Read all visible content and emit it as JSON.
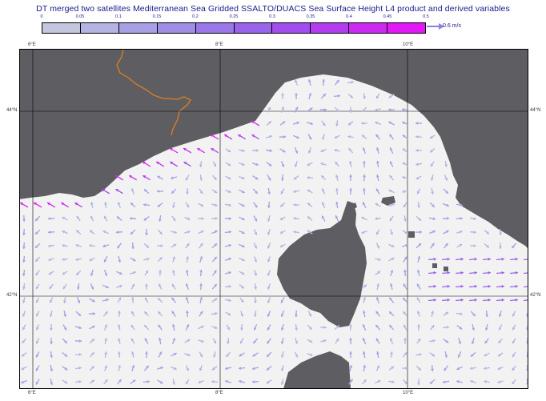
{
  "title": "DT merged two satellites Mediterranean Sea Gridded SSALTO/DUACS Sea Surface Height L4 product and derived variables",
  "colorbar": {
    "ticks": [
      "0",
      "0.05",
      "0.1",
      "0.15",
      "0.2",
      "0.25",
      "0.3",
      "0.35",
      "0.4",
      "0.45",
      "0.5"
    ],
    "colors": [
      "#c4c6dd",
      "#b4b3e3",
      "#a8a0e5",
      "#9f8de8",
      "#9a78ea",
      "#9a63ec",
      "#a24eee",
      "#b43cf0",
      "#cc2af2",
      "#e318f6"
    ],
    "unit": "0.6 m/s"
  },
  "axes": {
    "lon_labels": [
      "6°E",
      "8°E",
      "10°E"
    ],
    "lat_labels": [
      "44°N",
      "42°N"
    ],
    "lon_range": [
      5.85,
      11.05
    ],
    "lat_range": [
      40.9,
      44.65
    ]
  },
  "colors": {
    "sea": "#f2f2f2",
    "land": "#5e5e62",
    "border": "#e07d20",
    "grid": "#000000",
    "text": "#1a1a8c"
  }
}
